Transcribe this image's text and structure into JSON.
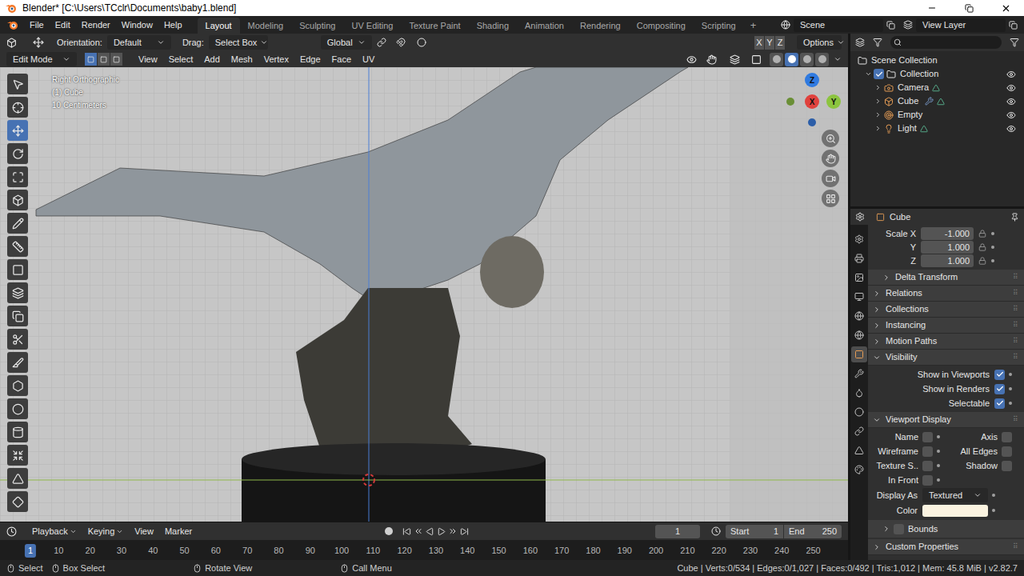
{
  "window": {
    "title": "Blender* [C:\\Users\\TCclr\\Documents\\baby1.blend]"
  },
  "menu": [
    "File",
    "Edit",
    "Render",
    "Window",
    "Help"
  ],
  "workspaces": [
    {
      "label": "Layout",
      "selected": true
    },
    {
      "label": "Modeling",
      "selected": false
    },
    {
      "label": "Sculpting",
      "selected": false
    },
    {
      "label": "UV Editing",
      "selected": false
    },
    {
      "label": "Texture Paint",
      "selected": false
    },
    {
      "label": "Shading",
      "selected": false
    },
    {
      "label": "Animation",
      "selected": false
    },
    {
      "label": "Rendering",
      "selected": false
    },
    {
      "label": "Compositing",
      "selected": false
    },
    {
      "label": "Scripting",
      "selected": false
    }
  ],
  "workspace_add": "+",
  "scene": "Scene",
  "view_layer": "View Layer",
  "tool_header": {
    "orientation_label": "Orientation:",
    "orientation": "Default",
    "drag_label": "Drag:",
    "drag": "Select Box",
    "transform": "Global",
    "mirror": [
      "X",
      "Y",
      "Z"
    ],
    "options": "Options"
  },
  "viewport_header": {
    "mode": "Edit Mode",
    "select_modes": [
      {
        "selected": true
      },
      {
        "selected": false
      },
      {
        "selected": false
      }
    ],
    "menus": [
      "View",
      "Select",
      "Add",
      "Mesh",
      "Vertex",
      "Edge",
      "Face",
      "UV"
    ],
    "shading": [
      {
        "selected": false
      },
      {
        "selected": true
      },
      {
        "selected": false
      },
      {
        "selected": false
      }
    ]
  },
  "viewport": {
    "overlay": [
      "Right Orthographic",
      "(1) Cube",
      "10 Centimeters"
    ],
    "gizmo": [
      {
        "label": "Z",
        "color": "#2f7ae0"
      },
      {
        "label": "X",
        "color": "#e0413d"
      },
      {
        "label": "Y",
        "color": "#8cc43f"
      }
    ]
  },
  "tools": [
    {
      "selected": false
    },
    {
      "selected": false
    },
    {
      "selected": true
    },
    {
      "selected": false
    },
    {
      "selected": false
    },
    {
      "selected": false
    },
    {
      "selected": false
    },
    {
      "selected": false
    },
    {
      "selected": false
    },
    {
      "selected": false
    },
    {
      "selected": false
    },
    {
      "selected": false
    },
    {
      "selected": false
    },
    {
      "selected": false
    },
    {
      "selected": false
    },
    {
      "selected": false
    },
    {
      "selected": false
    },
    {
      "selected": false
    },
    {
      "selected": false
    }
  ],
  "outliner": {
    "root": {
      "label": "Scene Collection",
      "kind": "scene",
      "children": [
        {
          "label": "Collection",
          "kind": "collection",
          "expanded": true,
          "checked": true,
          "visible": true,
          "children": [
            {
              "label": "Camera",
              "kind": "camera",
              "expanded": false,
              "visible": true
            },
            {
              "label": "Cube",
              "kind": "mesh",
              "expanded": false,
              "visible": true
            },
            {
              "label": "Empty",
              "kind": "empty",
              "expanded": false,
              "visible": true
            },
            {
              "label": "Light",
              "kind": "light",
              "expanded": false,
              "visible": true
            }
          ]
        }
      ]
    }
  },
  "properties": {
    "object_name": "Cube",
    "tabs": [
      {
        "selected": false
      },
      {
        "selected": false
      },
      {
        "selected": false
      },
      {
        "selected": false
      },
      {
        "selected": false
      },
      {
        "selected": false
      },
      {
        "selected": true
      },
      {
        "selected": false
      },
      {
        "selected": false
      },
      {
        "selected": false
      },
      {
        "selected": false
      },
      {
        "selected": false
      },
      {
        "selected": false
      }
    ],
    "scale": [
      {
        "label": "Scale X",
        "value": "-1.000"
      },
      {
        "label": "Y",
        "value": "1.000"
      },
      {
        "label": "Z",
        "value": "1.000"
      }
    ],
    "delta": {
      "label": "Delta Transform",
      "expanded": false
    },
    "panels": [
      {
        "label": "Relations",
        "expanded": false
      },
      {
        "label": "Collections",
        "expanded": false
      },
      {
        "label": "Instancing",
        "expanded": false
      },
      {
        "label": "Motion Paths",
        "expanded": false
      }
    ],
    "visibility": {
      "label": "Visibility",
      "expanded": true,
      "options": [
        {
          "label": "Show in Viewports",
          "checked": true
        },
        {
          "label": "Show in Renders",
          "checked": true
        },
        {
          "label": "Selectable",
          "checked": true
        }
      ]
    },
    "viewport_display": {
      "label": "Viewport Display",
      "expanded": true,
      "rows": [
        [
          {
            "label": "Name",
            "checked": false
          },
          {
            "label": "Axis",
            "checked": false
          }
        ],
        [
          {
            "label": "Wireframe",
            "checked": false
          },
          {
            "label": "All Edges",
            "checked": false
          }
        ],
        [
          {
            "label": "Texture S..",
            "checked": false
          },
          {
            "label": "Shadow",
            "checked": false
          }
        ],
        [
          {
            "label": "In Front",
            "checked": false
          }
        ]
      ],
      "display_as": {
        "label": "Display As",
        "value": "Textured"
      },
      "color": {
        "label": "Color",
        "color": "#fbf3e0"
      },
      "bounds": {
        "label": "Bounds",
        "checked": false,
        "expanded": false
      }
    },
    "custom_properties": {
      "label": "Custom Properties",
      "expanded": false
    }
  },
  "timeline": {
    "menus": [
      "Playback",
      "Keying",
      "View",
      "Marker"
    ],
    "frame": "1",
    "start_label": "Start",
    "start": "1",
    "end_label": "End",
    "end": "250",
    "ruler": [
      {
        "label": "1",
        "selected": true
      },
      {
        "label": "10",
        "selected": false
      },
      {
        "label": "20",
        "selected": false
      },
      {
        "label": "30",
        "selected": false
      },
      {
        "label": "40",
        "selected": false
      },
      {
        "label": "50",
        "selected": false
      },
      {
        "label": "60",
        "selected": false
      },
      {
        "label": "70",
        "selected": false
      },
      {
        "label": "80",
        "selected": false
      },
      {
        "label": "90",
        "selected": false
      },
      {
        "label": "100",
        "selected": false
      },
      {
        "label": "110",
        "selected": false
      },
      {
        "label": "120",
        "selected": false
      },
      {
        "label": "130",
        "selected": false
      },
      {
        "label": "140",
        "selected": false
      },
      {
        "label": "150",
        "selected": false
      },
      {
        "label": "160",
        "selected": false
      },
      {
        "label": "170",
        "selected": false
      },
      {
        "label": "180",
        "selected": false
      },
      {
        "label": "190",
        "selected": false
      },
      {
        "label": "200",
        "selected": false
      },
      {
        "label": "210",
        "selected": false
      },
      {
        "label": "220",
        "selected": false
      },
      {
        "label": "230",
        "selected": false
      },
      {
        "label": "240",
        "selected": false
      },
      {
        "label": "250",
        "selected": false
      }
    ]
  },
  "status_bar": {
    "hints": [
      "Select",
      "Box Select",
      "Rotate View",
      "Call Menu"
    ],
    "stats": "Cube | Verts:0/534 | Edges:0/1,027 | Faces:0/492 | Tris:1,012 | Mem: 45.8 MiB | v2.82.7"
  }
}
